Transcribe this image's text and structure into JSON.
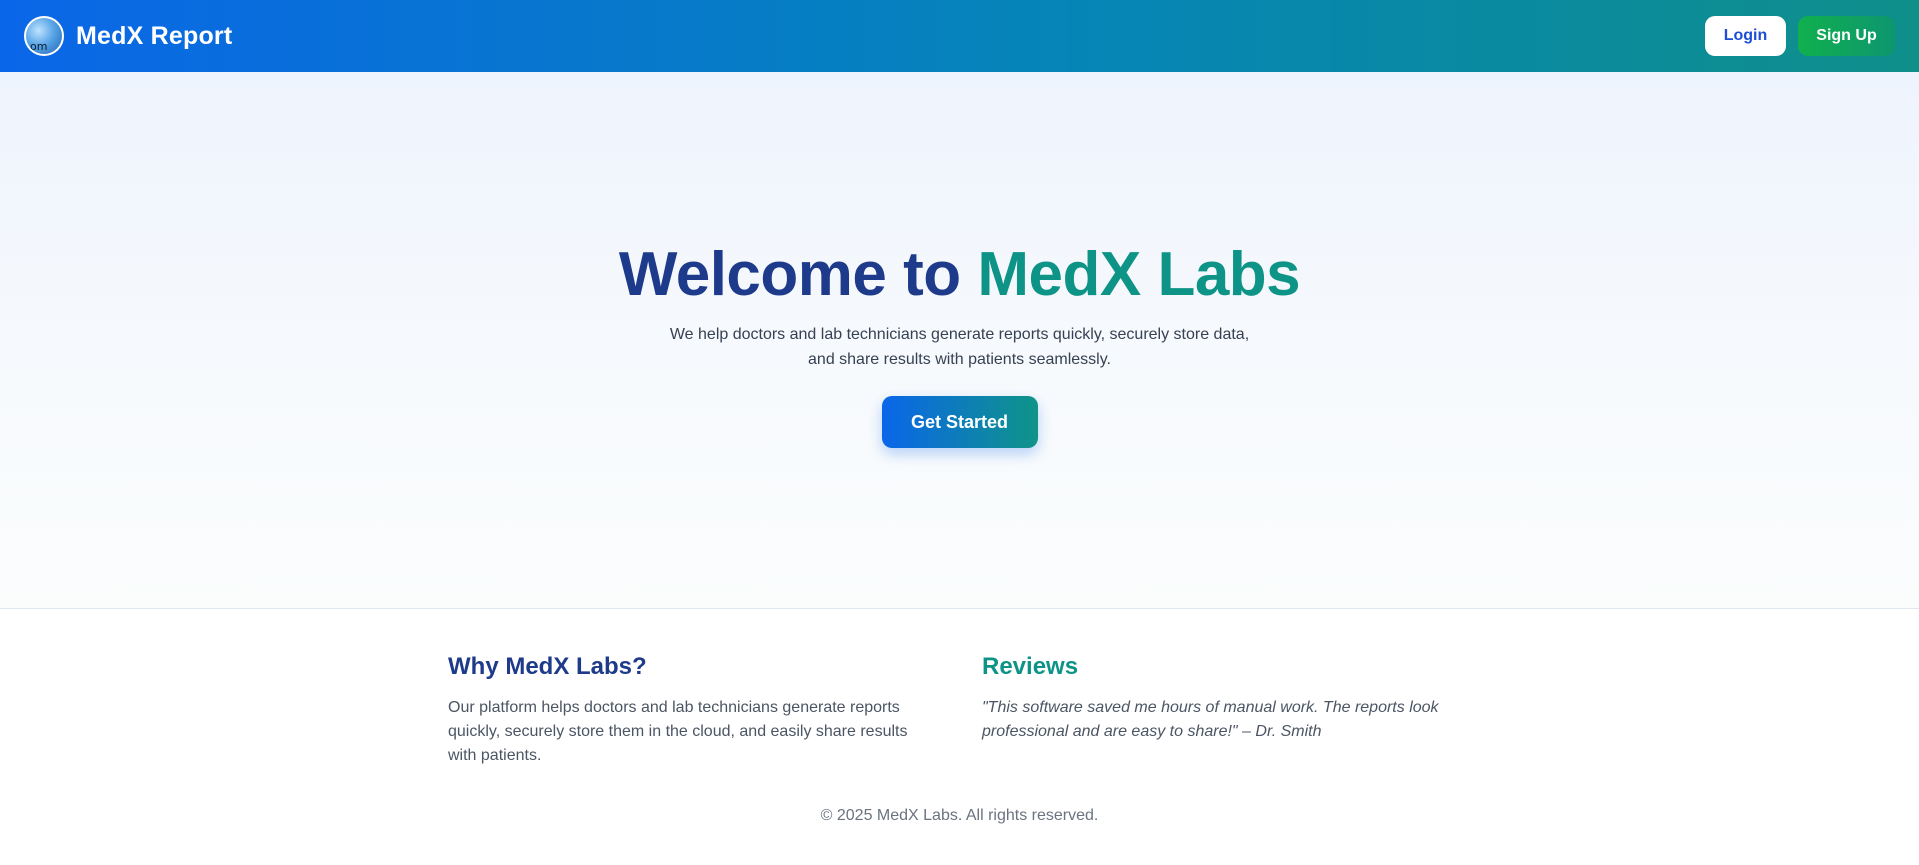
{
  "header": {
    "brand_name": "MedX Report",
    "logo_alt": "om",
    "login_label": "Login",
    "signup_label": "Sign Up"
  },
  "hero": {
    "title_part1": "Welcome to",
    "title_part2": "MedX Labs",
    "description_line1": "We help doctors and lab technicians generate reports quickly, securely store data,",
    "description_line2": "and share results with patients seamlessly.",
    "cta_label": "Get Started"
  },
  "why": {
    "heading": "Why MedX Labs?",
    "body": "Our platform helps doctors and lab technicians generate reports quickly, securely store them in the cloud, and easily share results with patients."
  },
  "reviews": {
    "heading": "Reviews",
    "body": "\"This software saved me hours of manual work. The reports look professional and are easy to share!\" – Dr. Smith"
  },
  "footer": {
    "copyright": "© 2025 MedX Labs. All rights reserved."
  },
  "colors": {
    "header_gradient_start": "#0a66e8",
    "header_gradient_end": "#0f8f8a",
    "navy": "#1e3a8a",
    "teal": "#0e9486",
    "signup_green": "#10b04e"
  },
  "icons": {
    "logo": "globe-logo-icon"
  }
}
